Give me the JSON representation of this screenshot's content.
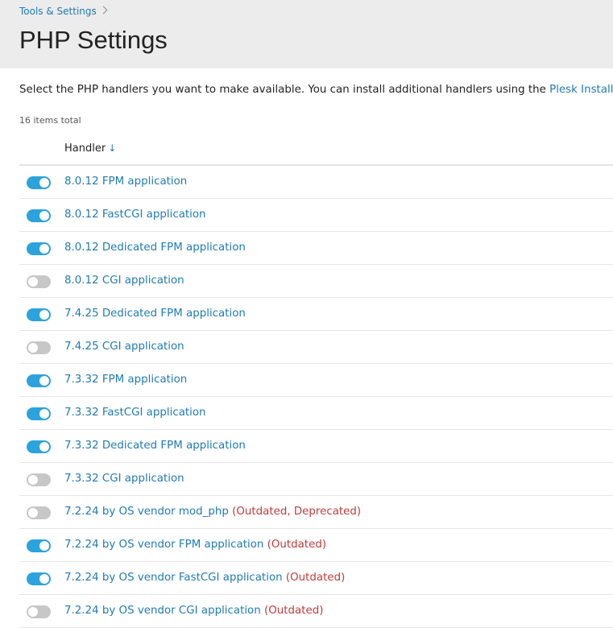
{
  "breadcrumb": {
    "items": [
      "Tools & Settings"
    ]
  },
  "page": {
    "title": "PHP Settings",
    "intro_text": "Select the PHP handlers you want to make available. You can install additional handlers using the ",
    "intro_link": "Plesk Installer",
    "intro_end": ".",
    "count_text": "16 items total"
  },
  "table": {
    "column_header": "Handler",
    "sort": "descending",
    "rows": [
      {
        "label": "8.0.12 FPM application",
        "note": "",
        "enabled": true
      },
      {
        "label": "8.0.12 FastCGI application",
        "note": "",
        "enabled": true
      },
      {
        "label": "8.0.12 Dedicated FPM application",
        "note": "",
        "enabled": true
      },
      {
        "label": "8.0.12 CGI application",
        "note": "",
        "enabled": false
      },
      {
        "label": "7.4.25 Dedicated FPM application",
        "note": "",
        "enabled": true
      },
      {
        "label": "7.4.25 CGI application",
        "note": "",
        "enabled": false
      },
      {
        "label": "7.3.32 FPM application",
        "note": "",
        "enabled": true
      },
      {
        "label": "7.3.32 FastCGI application",
        "note": "",
        "enabled": true
      },
      {
        "label": "7.3.32 Dedicated FPM application",
        "note": "",
        "enabled": true
      },
      {
        "label": "7.3.32 CGI application",
        "note": "",
        "enabled": false
      },
      {
        "label": "7.2.24 by OS vendor mod_php",
        "note": "(Outdated, Deprecated)",
        "enabled": false
      },
      {
        "label": "7.2.24 by OS vendor FPM application",
        "note": "(Outdated)",
        "enabled": true
      },
      {
        "label": "7.2.24 by OS vendor FastCGI application",
        "note": "(Outdated)",
        "enabled": true
      },
      {
        "label": "7.2.24 by OS vendor CGI application",
        "note": "(Outdated)",
        "enabled": false
      }
    ]
  },
  "colors": {
    "link": "#1f7bb6",
    "toggle_on": "#2ba3dc",
    "toggle_off": "#c7c7c7",
    "warning": "#c23b3b",
    "header_bg": "#ececec"
  }
}
